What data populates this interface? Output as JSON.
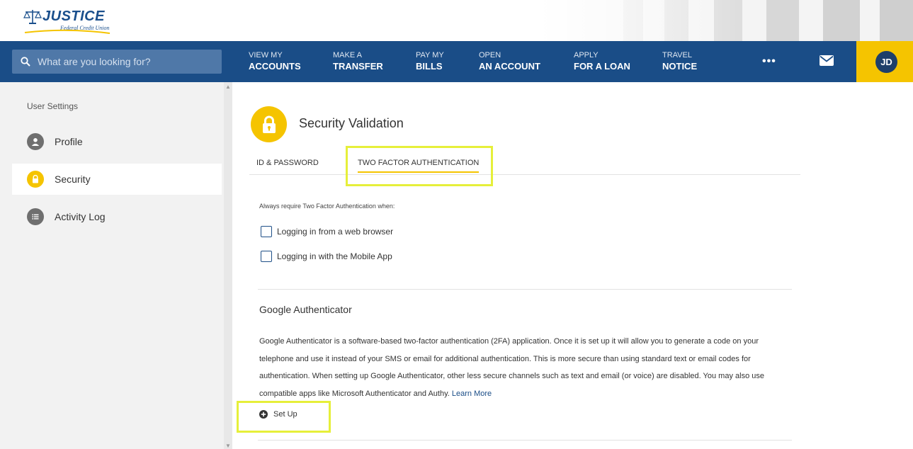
{
  "brand": {
    "name": "JUSTICE",
    "tagline": "Federal Credit Union"
  },
  "search": {
    "placeholder": "What are you looking for?"
  },
  "nav": [
    {
      "top": "VIEW MY",
      "bottom": "ACCOUNTS"
    },
    {
      "top": "MAKE A",
      "bottom": "TRANSFER"
    },
    {
      "top": "PAY MY",
      "bottom": "BILLS"
    },
    {
      "top": "OPEN",
      "bottom": "AN ACCOUNT"
    },
    {
      "top": "APPLY",
      "bottom": "FOR A LOAN"
    },
    {
      "top": "TRAVEL",
      "bottom": "NOTICE"
    }
  ],
  "more_label": "•••",
  "user": {
    "initials": "JD"
  },
  "sidebar": {
    "heading": "User Settings",
    "items": [
      {
        "label": "Profile",
        "icon": "person-icon",
        "active": false
      },
      {
        "label": "Security",
        "icon": "lock-icon",
        "active": true
      },
      {
        "label": "Activity Log",
        "icon": "list-icon",
        "active": false
      }
    ]
  },
  "main": {
    "title": "Security Validation",
    "tabs": [
      {
        "label": "ID & PASSWORD",
        "active": false
      },
      {
        "label": "TWO FACTOR AUTHENTICATION",
        "active": true
      }
    ],
    "intro": "Always require Two Factor Authentication when:",
    "options": [
      {
        "label": "Logging in from a web browser",
        "checked": false
      },
      {
        "label": "Logging in with the Mobile App",
        "checked": false
      }
    ],
    "ga_title": "Google Authenticator",
    "ga_text": "Google Authenticator is a software-based two-factor authentication (2FA) application. Once it is set up it will allow you to generate a code on your telephone and use it instead of your SMS or email for additional authentication. This is more secure than using standard text or email codes for authentication. When setting up Google Authenticator, other less secure channels such as text and email (or voice) are disabled. You may also use compatible apps like Microsoft Authenticator and Authy.",
    "learn_more": "Learn More",
    "setup_label": "Set Up"
  },
  "colors": {
    "navy": "#1a4d87",
    "accent": "#f5c400",
    "highlight": "#e6ef3a"
  }
}
